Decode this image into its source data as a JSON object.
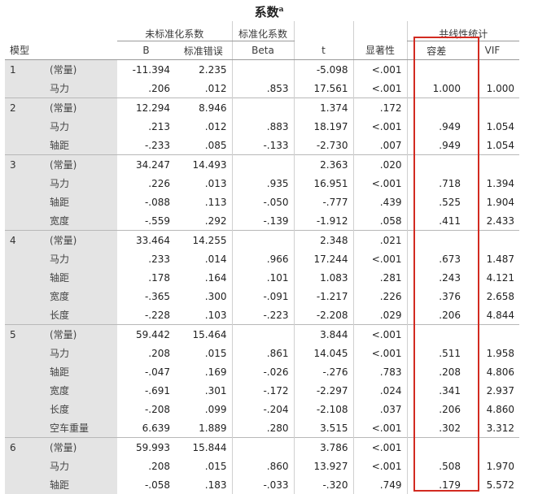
{
  "title": "系数",
  "title_sup": "a",
  "header": {
    "group_unstd": "未标准化系数",
    "group_std": "标准化系数",
    "group_collinearity": "共线性统计",
    "col_model": "模型",
    "col_b": "B",
    "col_se": "标准错误",
    "col_beta": "Beta",
    "col_t": "t",
    "col_sig": "显著性",
    "col_tol": "容差",
    "col_vif": "VIF"
  },
  "rows": [
    {
      "model": "1",
      "var": "(常量)",
      "b": "-11.394",
      "se": "2.235",
      "beta": "",
      "t": "-5.098",
      "sig": "<.001",
      "tol": "",
      "vif": "",
      "first": true
    },
    {
      "model": "",
      "var": "马力",
      "b": ".206",
      "se": ".012",
      "beta": ".853",
      "t": "17.561",
      "sig": "<.001",
      "tol": "1.000",
      "vif": "1.000"
    },
    {
      "model": "2",
      "var": "(常量)",
      "b": "12.294",
      "se": "8.946",
      "beta": "",
      "t": "1.374",
      "sig": ".172",
      "tol": "",
      "vif": "",
      "first": true
    },
    {
      "model": "",
      "var": "马力",
      "b": ".213",
      "se": ".012",
      "beta": ".883",
      "t": "18.197",
      "sig": "<.001",
      "tol": ".949",
      "vif": "1.054"
    },
    {
      "model": "",
      "var": "轴距",
      "b": "-.233",
      "se": ".085",
      "beta": "-.133",
      "t": "-2.730",
      "sig": ".007",
      "tol": ".949",
      "vif": "1.054"
    },
    {
      "model": "3",
      "var": "(常量)",
      "b": "34.247",
      "se": "14.493",
      "beta": "",
      "t": "2.363",
      "sig": ".020",
      "tol": "",
      "vif": "",
      "first": true
    },
    {
      "model": "",
      "var": "马力",
      "b": ".226",
      "se": ".013",
      "beta": ".935",
      "t": "16.951",
      "sig": "<.001",
      "tol": ".718",
      "vif": "1.394"
    },
    {
      "model": "",
      "var": "轴距",
      "b": "-.088",
      "se": ".113",
      "beta": "-.050",
      "t": "-.777",
      "sig": ".439",
      "tol": ".525",
      "vif": "1.904"
    },
    {
      "model": "",
      "var": "宽度",
      "b": "-.559",
      "se": ".292",
      "beta": "-.139",
      "t": "-1.912",
      "sig": ".058",
      "tol": ".411",
      "vif": "2.433"
    },
    {
      "model": "4",
      "var": "(常量)",
      "b": "33.464",
      "se": "14.255",
      "beta": "",
      "t": "2.348",
      "sig": ".021",
      "tol": "",
      "vif": "",
      "first": true
    },
    {
      "model": "",
      "var": "马力",
      "b": ".233",
      "se": ".014",
      "beta": ".966",
      "t": "17.244",
      "sig": "<.001",
      "tol": ".673",
      "vif": "1.487"
    },
    {
      "model": "",
      "var": "轴距",
      "b": ".178",
      "se": ".164",
      "beta": ".101",
      "t": "1.083",
      "sig": ".281",
      "tol": ".243",
      "vif": "4.121"
    },
    {
      "model": "",
      "var": "宽度",
      "b": "-.365",
      "se": ".300",
      "beta": "-.091",
      "t": "-1.217",
      "sig": ".226",
      "tol": ".376",
      "vif": "2.658"
    },
    {
      "model": "",
      "var": "长度",
      "b": "-.228",
      "se": ".103",
      "beta": "-.223",
      "t": "-2.208",
      "sig": ".029",
      "tol": ".206",
      "vif": "4.844"
    },
    {
      "model": "5",
      "var": "(常量)",
      "b": "59.442",
      "se": "15.464",
      "beta": "",
      "t": "3.844",
      "sig": "<.001",
      "tol": "",
      "vif": "",
      "first": true
    },
    {
      "model": "",
      "var": "马力",
      "b": ".208",
      "se": ".015",
      "beta": ".861",
      "t": "14.045",
      "sig": "<.001",
      "tol": ".511",
      "vif": "1.958"
    },
    {
      "model": "",
      "var": "轴距",
      "b": "-.047",
      "se": ".169",
      "beta": "-.026",
      "t": "-.276",
      "sig": ".783",
      "tol": ".208",
      "vif": "4.806"
    },
    {
      "model": "",
      "var": "宽度",
      "b": "-.691",
      "se": ".301",
      "beta": "-.172",
      "t": "-2.297",
      "sig": ".024",
      "tol": ".341",
      "vif": "2.937"
    },
    {
      "model": "",
      "var": "长度",
      "b": "-.208",
      "se": ".099",
      "beta": "-.204",
      "t": "-2.108",
      "sig": ".037",
      "tol": ".206",
      "vif": "4.860"
    },
    {
      "model": "",
      "var": "空车重量",
      "b": "6.639",
      "se": "1.889",
      "beta": ".280",
      "t": "3.515",
      "sig": "<.001",
      "tol": ".302",
      "vif": "3.312"
    },
    {
      "model": "6",
      "var": "(常量)",
      "b": "59.993",
      "se": "15.844",
      "beta": "",
      "t": "3.786",
      "sig": "<.001",
      "tol": "",
      "vif": "",
      "first": true
    },
    {
      "model": "",
      "var": "马力",
      "b": ".208",
      "se": ".015",
      "beta": ".860",
      "t": "13.927",
      "sig": "<.001",
      "tol": ".508",
      "vif": "1.970"
    },
    {
      "model": "",
      "var": "轴距",
      "b": "-.058",
      "se": ".183",
      "beta": "-.033",
      "t": "-.320",
      "sig": ".749",
      "tol": ".179",
      "vif": "5.572"
    }
  ],
  "highlight_color": "#d22b21"
}
